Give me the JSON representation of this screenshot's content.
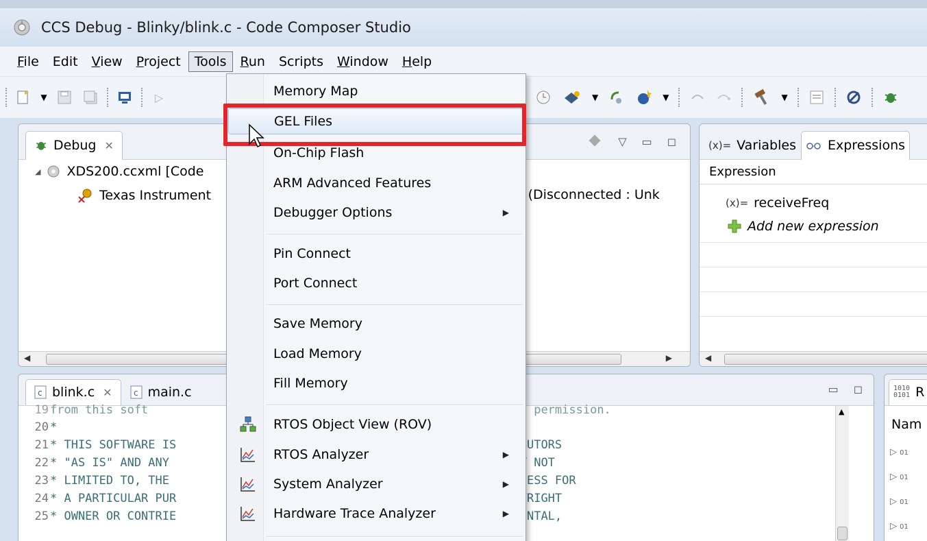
{
  "window": {
    "title": "CCS Debug - Blinky/blink.c - Code Composer Studio",
    "app_icon": "ccs-logo-icon"
  },
  "menubar": {
    "items": [
      {
        "label": "File",
        "mnemonic": "F"
      },
      {
        "label": "Edit"
      },
      {
        "label": "View",
        "mnemonic": "V"
      },
      {
        "label": "Project",
        "mnemonic": "P"
      },
      {
        "label": "Tools",
        "active": true
      },
      {
        "label": "Run",
        "mnemonic": "R"
      },
      {
        "label": "Scripts"
      },
      {
        "label": "Window",
        "mnemonic": "W"
      },
      {
        "label": "Help",
        "mnemonic": "H"
      }
    ]
  },
  "tools_menu": {
    "items": [
      {
        "label": "Memory Map"
      },
      {
        "label": "GEL Files",
        "highlighted": true
      },
      {
        "label": "On-Chip Flash"
      },
      {
        "label": "ARM Advanced Features"
      },
      {
        "label": "Debugger Options",
        "submenu": true
      },
      {
        "label": "Pin Connect"
      },
      {
        "label": "Port Connect"
      },
      {
        "label": "Save Memory"
      },
      {
        "label": "Load Memory"
      },
      {
        "label": "Fill Memory"
      },
      {
        "label": "RTOS Object View (ROV)",
        "icon": "rov-icon"
      },
      {
        "label": "RTOS Analyzer",
        "icon": "analyzer-chart-icon",
        "submenu": true
      },
      {
        "label": "System Analyzer",
        "icon": "analyzer-chart-icon",
        "submenu": true
      },
      {
        "label": "Hardware Trace Analyzer",
        "icon": "analyzer-chart-icon",
        "submenu": true
      }
    ]
  },
  "debug_view": {
    "tab_label": "Debug",
    "tree": [
      {
        "label": "XDS200.ccxml [Code"
      },
      {
        "label": "Texas Instrument",
        "suffix": "_0 (Disconnected : Unk"
      }
    ]
  },
  "variables_view": {
    "tabs": [
      {
        "label": "Variables",
        "prefix": "(x)="
      },
      {
        "label": "Expressions"
      }
    ],
    "column_header": "Expression",
    "rows": [
      {
        "label": "receiveFreq",
        "prefix": "(x)="
      },
      {
        "label": "Add new expression"
      }
    ]
  },
  "editor": {
    "tabs": [
      {
        "label": "blink.c"
      },
      {
        "label": "main.c"
      }
    ],
    "partial_top_line": "from this soft                                                  tten permission.",
    "lines": [
      {
        "num": "20",
        "text": "*"
      },
      {
        "num": "21",
        "text": "* THIS SOFTWARE IS                                   ERS AND CONTRIBUTORS"
      },
      {
        "num": "22",
        "text": "* \"AS IS\" AND ANY                                     INCLUDING, BUT NOT"
      },
      {
        "num": "23",
        "text": "* LIMITED TO, THE                                    BILITY AND FITNESS FOR"
      },
      {
        "num": "24",
        "text": "* A PARTICULAR PUR                                  T SHALL THE COPYRIGHT"
      },
      {
        "num": "25",
        "text": "* OWNER OR CONTRIE                                  INDIRECT, INCIDENTAL,"
      }
    ]
  },
  "right_view": {
    "tab_label": "R",
    "column_header": "Nam"
  },
  "colors": {
    "highlight_box": "#e4252b",
    "menu_hover": "#dfeaf7"
  }
}
